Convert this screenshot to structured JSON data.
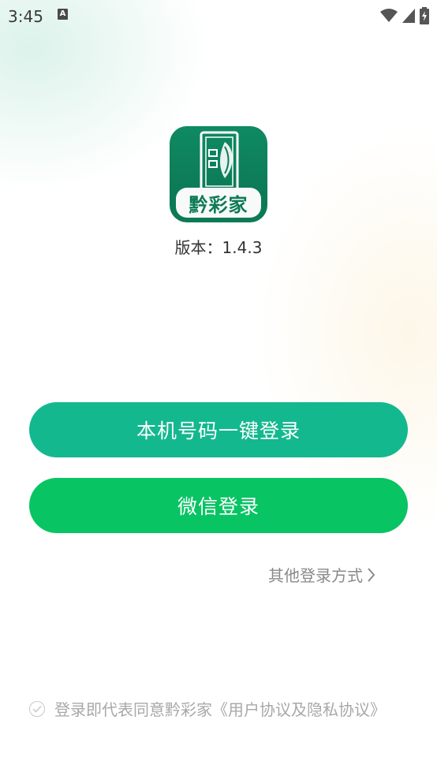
{
  "status_bar": {
    "time": "3:45",
    "notification_glyph": "A",
    "icons": [
      "wifi-icon",
      "signal-icon",
      "battery-charging-icon"
    ]
  },
  "app": {
    "logo_text": "黔彩家",
    "version": "版本：1.4.3"
  },
  "buttons": {
    "one_key_login": "本机号码一键登录",
    "wechat_login": "微信登录"
  },
  "other_login": {
    "label": "其他登录方式",
    "chevron": "›"
  },
  "agreement": {
    "text": "登录即代表同意黔彩家《用户协议及隐私协议》"
  },
  "colors": {
    "one_key_button": "#14b88f",
    "wechat_button": "#08c463",
    "logo_green": "#0c7a56"
  }
}
